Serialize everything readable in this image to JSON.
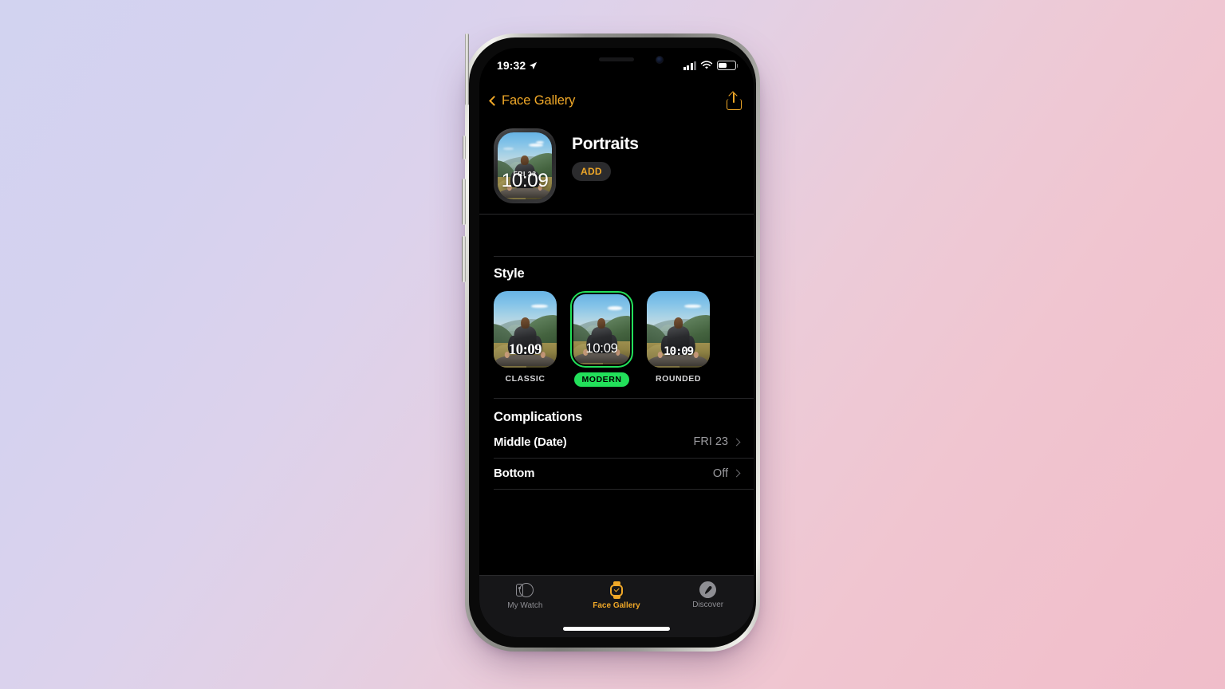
{
  "status_bar": {
    "time": "19:32",
    "location_icon": "location-arrow-icon",
    "signal_icon": "cellular-bars-icon",
    "wifi_icon": "wifi-icon",
    "battery_icon": "battery-icon"
  },
  "nav_bar": {
    "back_label": "Face Gallery",
    "back_icon": "chevron-left-icon",
    "share_icon": "share-icon"
  },
  "hero": {
    "title": "Portraits",
    "add_label": "ADD",
    "watch_preview": {
      "date": "FRI 23",
      "time": "10:09",
      "photo": "person-sitting-on-mountain-overlook"
    }
  },
  "style_section": {
    "title": "Style",
    "options": [
      {
        "label": "CLASSIC",
        "time": "10:09",
        "selected": false
      },
      {
        "label": "MODERN",
        "time": "10:09",
        "selected": true
      },
      {
        "label": "ROUNDED",
        "time": "10:09",
        "selected": false
      }
    ]
  },
  "complications_section": {
    "title": "Complications",
    "rows": [
      {
        "label": "Middle (Date)",
        "value": "FRI 23"
      },
      {
        "label": "Bottom",
        "value": "Off"
      }
    ]
  },
  "tab_bar": {
    "tabs": [
      {
        "label": "My Watch",
        "icon": "watch-side-icon",
        "active": false
      },
      {
        "label": "Face Gallery",
        "icon": "watch-face-icon",
        "active": true
      },
      {
        "label": "Discover",
        "icon": "compass-icon",
        "active": false
      }
    ]
  },
  "colors": {
    "accent_orange": "#f0a828",
    "selection_green": "#22e05a",
    "screen_background": "#000000",
    "secondary_text": "#9a9a9e"
  }
}
